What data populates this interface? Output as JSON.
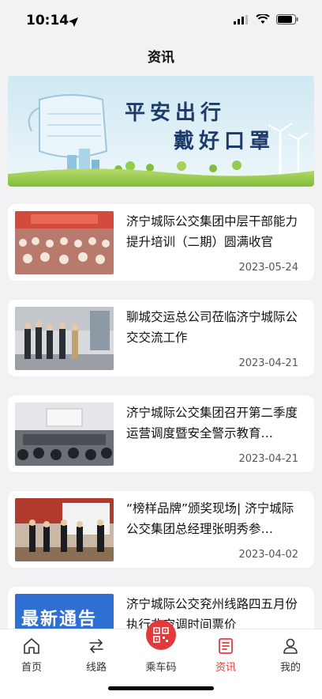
{
  "status": {
    "time": "10:14"
  },
  "nav": {
    "title": "资讯"
  },
  "banner": {
    "line1": "平安出行",
    "line2": "戴好口罩"
  },
  "news": [
    {
      "title": "济宁城际公交集团中层干部能力提升培训（二期）圆满收官",
      "date": "2023-05-24"
    },
    {
      "title": "聊城交运总公司莅临济宁城际公交交流工作",
      "date": "2023-04-21"
    },
    {
      "title": "济宁城际公交集团召开第二季度运营调度暨安全警示教育…",
      "date": "2023-04-21"
    },
    {
      "title": "“榜样品牌”颁奖现场| 济宁城际公交集团总经理张明秀参…",
      "date": "2023-04-02"
    },
    {
      "title": "济宁城际公交兖州线路四五月份执行非空调时间票价",
      "date": "",
      "thumb_text": "最新通告"
    }
  ],
  "tabs": [
    {
      "label": "首页",
      "icon": "home-icon"
    },
    {
      "label": "线路",
      "icon": "route-icon"
    },
    {
      "label": "乘车码",
      "icon": "qr-code-icon"
    },
    {
      "label": "资讯",
      "icon": "news-icon",
      "active": true
    },
    {
      "label": "我的",
      "icon": "user-icon"
    }
  ],
  "colors": {
    "accent": "#e23d3d",
    "background": "#f2f2f4"
  }
}
